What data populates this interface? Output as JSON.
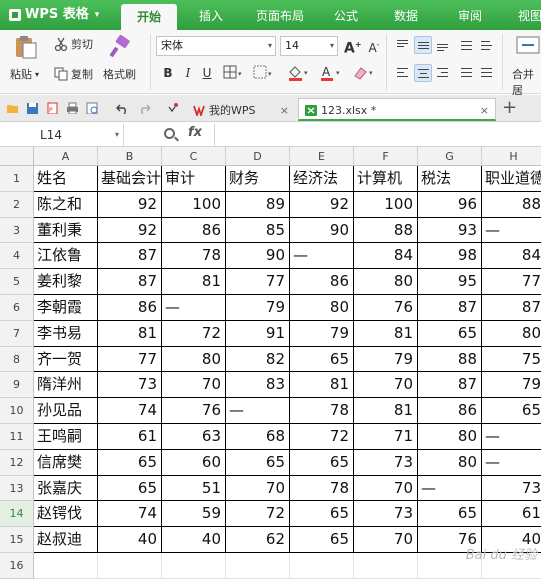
{
  "app": {
    "title": "WPS 表格"
  },
  "menu": {
    "tabs": [
      "开始",
      "插入",
      "页面布局",
      "公式",
      "数据",
      "审阅",
      "视图"
    ],
    "active": "开始"
  },
  "ribbon": {
    "paste": "粘贴",
    "cut": "剪切",
    "copy": "复制",
    "format_painter": "格式刷",
    "font_name": "宋体",
    "font_size": "14",
    "merge_center": "合并居",
    "bold": "B",
    "italic": "I",
    "underline": "U",
    "grow_font": "A",
    "shrink_font": "A"
  },
  "tabs": [
    {
      "label": "我的WPS",
      "close": "×"
    },
    {
      "label": "123.xlsx *",
      "close": "×"
    }
  ],
  "new_tab": "+",
  "formula_bar": {
    "name_box": "L14",
    "fx": "fx",
    "value": ""
  },
  "sheet": {
    "columns": [
      "A",
      "B",
      "C",
      "D",
      "E",
      "F",
      "G",
      "H"
    ],
    "rows": [
      "1",
      "2",
      "3",
      "4",
      "5",
      "6",
      "7",
      "8",
      "9",
      "10",
      "11",
      "12",
      "13",
      "14",
      "15",
      "16"
    ],
    "selected_row": "14",
    "header": [
      "姓名",
      "基础会计",
      "审计",
      "财务",
      "经济法",
      "计算机",
      "税法",
      "职业道德"
    ],
    "data": [
      [
        "陈之和",
        "92",
        "100",
        "89",
        "92",
        "100",
        "96",
        "88"
      ],
      [
        "董利秉",
        "92",
        "86",
        "85",
        "90",
        "88",
        "93",
        "—"
      ],
      [
        "江依鲁",
        "87",
        "78",
        "90",
        "—",
        "84",
        "98",
        "84"
      ],
      [
        "姜利黎",
        "87",
        "81",
        "77",
        "86",
        "80",
        "95",
        "77"
      ],
      [
        "李朝霞",
        "86",
        "—",
        "79",
        "80",
        "76",
        "87",
        "87"
      ],
      [
        "李书易",
        "81",
        "72",
        "91",
        "79",
        "81",
        "65",
        "80"
      ],
      [
        "齐一贺",
        "77",
        "80",
        "82",
        "65",
        "79",
        "88",
        "75"
      ],
      [
        "隋洋州",
        "73",
        "70",
        "83",
        "81",
        "70",
        "87",
        "79"
      ],
      [
        "孙见品",
        "74",
        "76",
        "—",
        "78",
        "81",
        "86",
        "65"
      ],
      [
        "王鸣嗣",
        "61",
        "63",
        "68",
        "72",
        "71",
        "80",
        "—"
      ],
      [
        "信席樊",
        "65",
        "60",
        "65",
        "65",
        "73",
        "80",
        "—"
      ],
      [
        "张嘉庆",
        "65",
        "51",
        "70",
        "78",
        "70",
        "—",
        "73"
      ],
      [
        "赵锷伐",
        "74",
        "59",
        "72",
        "65",
        "73",
        "65",
        "61"
      ],
      [
        "赵叔迪",
        "40",
        "40",
        "62",
        "65",
        "70",
        "76",
        "40"
      ]
    ]
  },
  "colors": {
    "accent": "#2f9f3d",
    "menubar": "#3db14a",
    "tab_active_border": "#3fa94a"
  },
  "icons": [
    "paste-icon",
    "cut-icon",
    "copy-icon",
    "format-painter-icon",
    "border-icon",
    "fill-color-icon",
    "font-color-icon",
    "align-icons",
    "save-icon",
    "pdf-icon",
    "print-icon",
    "undo-icon",
    "redo-icon",
    "search-icon"
  ]
}
